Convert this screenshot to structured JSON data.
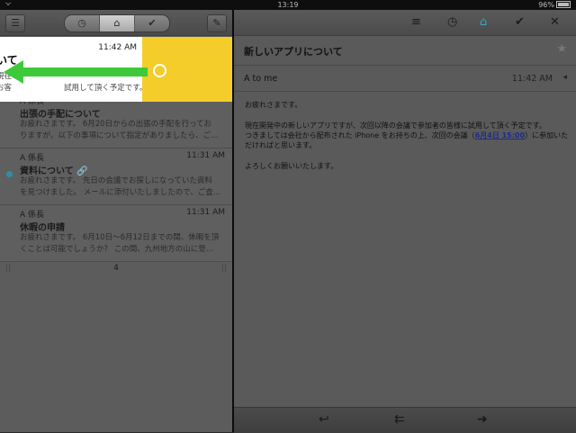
{
  "statusbar": {
    "time": "13:19",
    "battery": "96%"
  },
  "left": {
    "tabs": [
      "clock",
      "inbox",
      "check"
    ],
    "swiped": {
      "time": "11:42 AM",
      "subject": "いて",
      "preview_line1": "現在",
      "preview_line2": "お客",
      "preview_tail": "試用して頂く予定です。"
    },
    "items": [
      {
        "sender": "A 係長",
        "time": "11:33 AM",
        "subject": "出張の手配について",
        "preview1": "お疲れさまです。 6月20日からの出張の手配を行ってお",
        "preview2": "りますが、以下の事項について指定がありましたら、ご連…",
        "unread": false
      },
      {
        "sender": "A 係長",
        "time": "11:31 AM",
        "subject": "資料について",
        "preview1": "お疲れさまです。 先日の会議でお探しになっていた資料",
        "preview2": "を見つけました。 メールに添付いたしましたので、ご査…",
        "unread": true
      },
      {
        "sender": "A 係長",
        "time": "11:31 AM",
        "subject": "休暇の申請",
        "preview1": "お疲れさまです。 6月10日〜6月12日までの間、休暇を頂",
        "preview2": "くことは可能でしょうか？ この間、九州地方の山に登…",
        "unread": false
      }
    ],
    "page": "4"
  },
  "right": {
    "title": "新しいアプリについて",
    "to": "A to me",
    "time": "11:42 AM",
    "body": {
      "p1": "お疲れさまです。",
      "p2a": "現在開発中の新しいアプリですが、次回以降の会議で参加者の皆様に試用して頂く予定です。",
      "p2b_pre": "つきましては会社から配布された iPhone をお持ちの上、次回の会議（",
      "p2b_link": "6月4日 15:00",
      "p2b_post": "）に参加いただければと思います。",
      "p3": "よろしくお願いいたします。"
    }
  },
  "colors": {
    "swipe": "#f4cd2a",
    "arrow": "#3dc93a",
    "unread": "#2f8ea5"
  }
}
